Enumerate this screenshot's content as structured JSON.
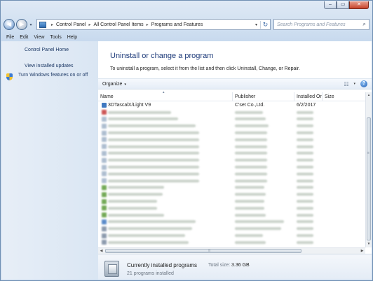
{
  "window": {
    "buttons": {
      "minimize": "–",
      "maximize": "▭",
      "close": "✕"
    }
  },
  "nav": {
    "back": "◀",
    "forward": "▶",
    "dropdown": "▾"
  },
  "address": {
    "breadcrumbs": [
      "Control Panel",
      "All Control Panel Items",
      "Programs and Features"
    ],
    "separator": "▸",
    "dropdown": "▾",
    "refresh": "↻"
  },
  "search": {
    "placeholder": "Search Programs and Features",
    "icon": "search-icon"
  },
  "menubar": [
    "File",
    "Edit",
    "View",
    "Tools",
    "Help"
  ],
  "leftpane": {
    "home_link": "Control Panel Home",
    "updates_link": "View installed updates",
    "features_link": "Turn Windows features on or off"
  },
  "main": {
    "heading": "Uninstall or change a program",
    "subtext": "To uninstall a program, select it from the list and then click Uninstall, Change, or Repair."
  },
  "toolbar": {
    "organize": "Organize",
    "organize_dd": "▾",
    "views_icon": "☷",
    "views_dd": "▾",
    "help": "?"
  },
  "columns": {
    "name": "Name",
    "publisher": "Publisher",
    "installed_on": "Installed On",
    "size": "Size",
    "sort_arrow": "▴",
    "header_scroll_arrow": "▴"
  },
  "programs": [
    {
      "name": "3DTascalX/Light V9",
      "publisher": "C'set Co.,Ltd.",
      "installed_on": "6/2/2017",
      "icon_color": "#3f78c0",
      "blurred": false
    },
    {
      "blurred": true,
      "icon_color": "#c43a3a"
    },
    {
      "blurred": true,
      "icon_color": "#9fb2c8"
    },
    {
      "blurred": true,
      "icon_color": "#9fb2c8"
    },
    {
      "blurred": true,
      "icon_color": "#9fb2c8"
    },
    {
      "blurred": true,
      "icon_color": "#9fb2c8"
    },
    {
      "blurred": true,
      "icon_color": "#9fb2c8"
    },
    {
      "blurred": true,
      "icon_color": "#9fb2c8"
    },
    {
      "blurred": true,
      "icon_color": "#9fb2c8"
    },
    {
      "blurred": true,
      "icon_color": "#9fb2c8"
    },
    {
      "blurred": true,
      "icon_color": "#9fb2c8"
    },
    {
      "blurred": true,
      "icon_color": "#9fb2c8"
    },
    {
      "blurred": true,
      "icon_color": "#5c9b3a"
    },
    {
      "blurred": true,
      "icon_color": "#5c9b3a"
    },
    {
      "blurred": true,
      "icon_color": "#5c9b3a"
    },
    {
      "blurred": true,
      "icon_color": "#5c9b3a"
    },
    {
      "blurred": true,
      "icon_color": "#5c9b3a"
    },
    {
      "blurred": true,
      "icon_color": "#3f78c0"
    },
    {
      "blurred": true,
      "icon_color": "#7a8aa0"
    },
    {
      "blurred": true,
      "icon_color": "#7a8aa0"
    },
    {
      "blurred": true,
      "icon_color": "#7a8aa0"
    }
  ],
  "scrollbars": {
    "up": "▲",
    "down": "▼",
    "left": "◀",
    "right": "▶",
    "grip_v": "≡",
    "grip_h": "⦙⦙⦙"
  },
  "details": {
    "title": "Currently installed programs",
    "total_size_label": "Total size:",
    "total_size_value": "3.36 GB",
    "count": "21 programs installed"
  }
}
